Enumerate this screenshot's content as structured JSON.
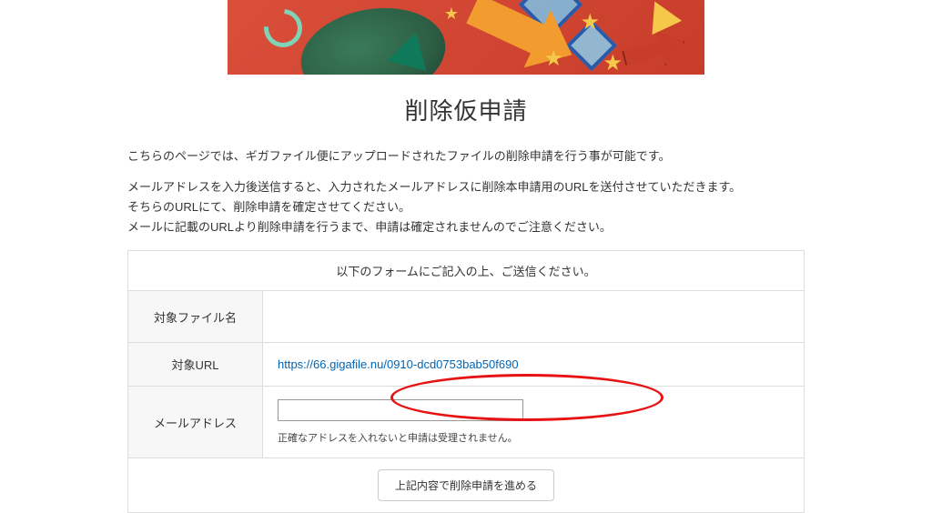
{
  "page": {
    "title": "削除仮申請",
    "intro1": "こちらのページでは、ギガファイル便にアップロードされたファイルの削除申請を行う事が可能です。",
    "intro2a": "メールアドレスを入力後送信すると、入力されたメールアドレスに削除本申請用のURLを送付させていただきます。",
    "intro2b": "そちらのURLにて、削除申請を確定させてください。",
    "intro2c": "メールに記載のURLより削除申請を行うまで、申請は確定されませんのでご注意ください。"
  },
  "form": {
    "caption": "以下のフォームにご記入の上、ご送信ください。",
    "rows": {
      "filename": {
        "label": "対象ファイル名",
        "value": ""
      },
      "url": {
        "label": "対象URL",
        "value": "https://66.gigafile.nu/0910-dcd0753bab50f690"
      },
      "email": {
        "label": "メールアドレス",
        "value": "",
        "note": "正確なアドレスを入れないと申請は受理されません。"
      }
    },
    "submit_label": "上記内容で削除申請を進める"
  }
}
